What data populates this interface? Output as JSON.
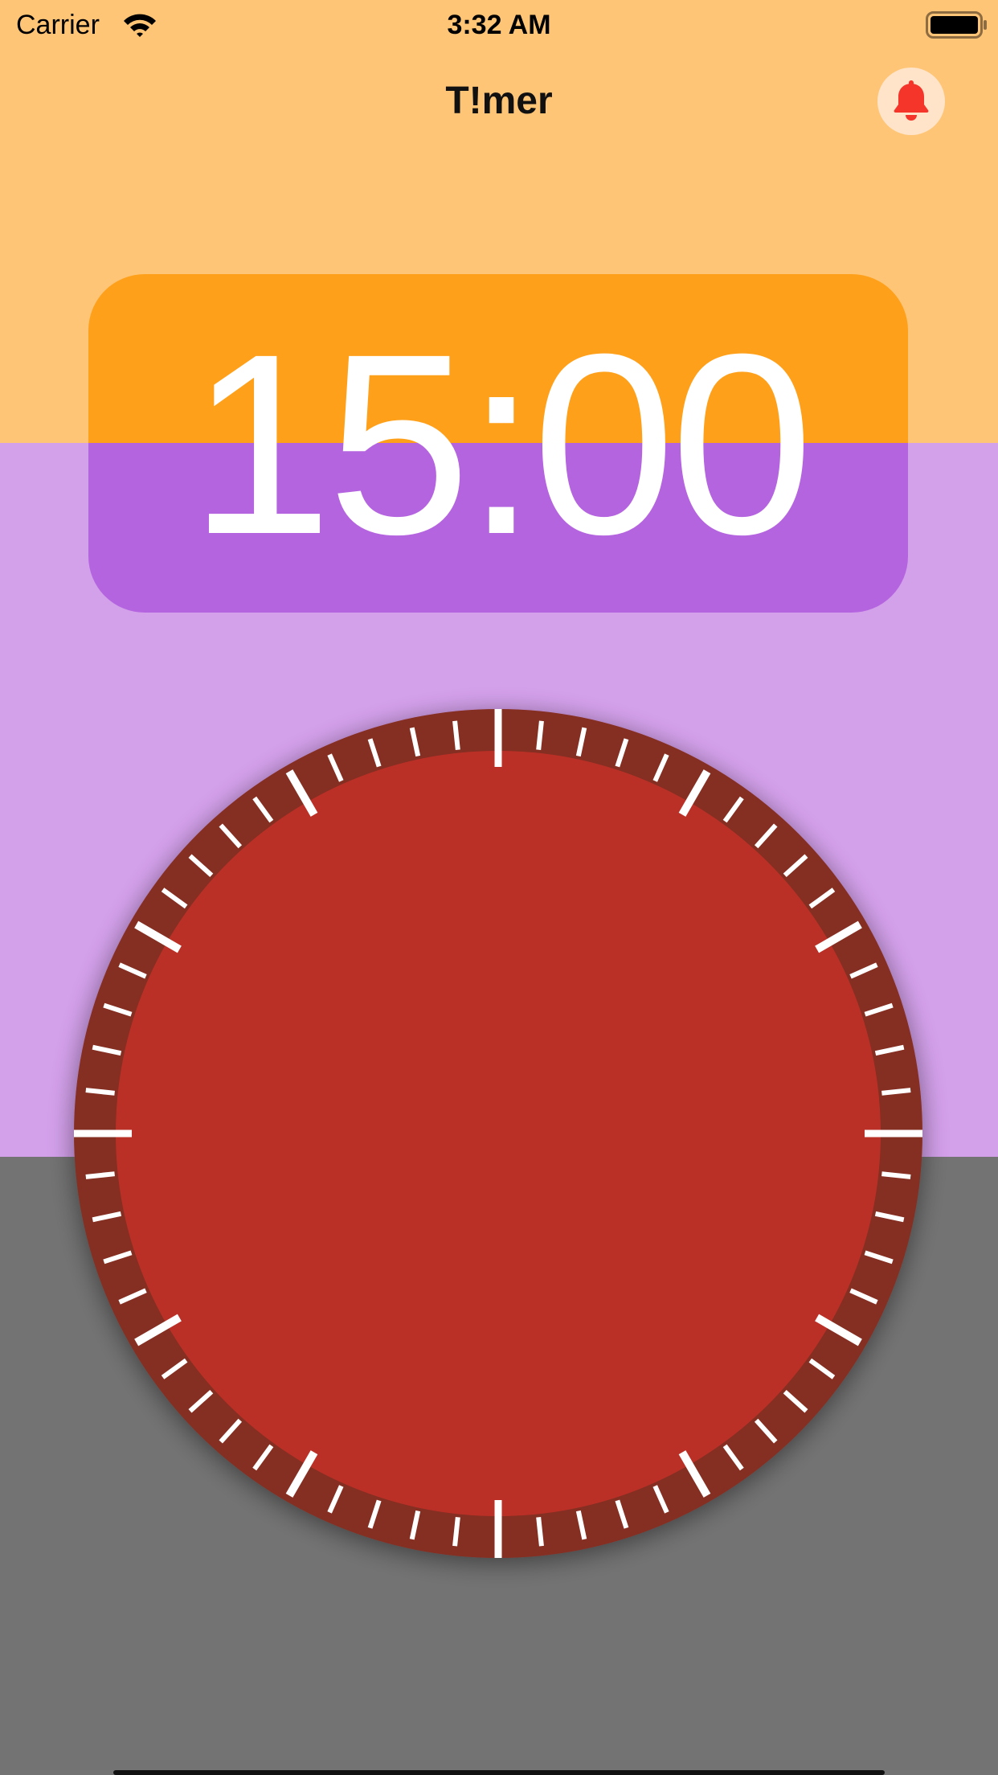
{
  "status_bar": {
    "carrier": "Carrier",
    "time": "3:32 AM",
    "wifi_icon": "wifi-icon",
    "battery_icon": "battery-full-icon"
  },
  "nav": {
    "title": "T!mer",
    "bell_icon": "bell-icon"
  },
  "timer": {
    "display": "15:00"
  },
  "dial": {
    "tick_count": 60,
    "major_every": 5,
    "cardinal_every": 15
  },
  "colors": {
    "top_band": "#FFC576",
    "mid_band": "#D3A0EA",
    "bottom_band": "#737373",
    "card_top": "#FFA01B",
    "card_bottom": "#B564E0",
    "dial_ring": "#852E24",
    "dial_face": "#BA3027",
    "tick": "#FFFFFF",
    "bell": "#F5352A",
    "bell_bg": "#FFE4C9"
  }
}
